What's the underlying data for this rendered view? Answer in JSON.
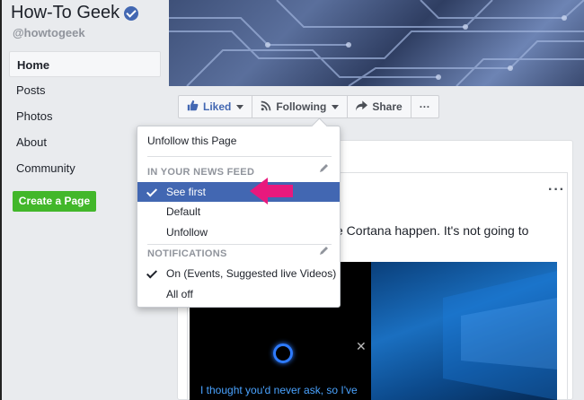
{
  "sidebar": {
    "page_name": "How-To Geek",
    "handle": "@howtogeek",
    "items": [
      {
        "label": "Home",
        "active": true
      },
      {
        "label": "Posts"
      },
      {
        "label": "Photos"
      },
      {
        "label": "About"
      },
      {
        "label": "Community"
      }
    ],
    "create_label": "Create a Page"
  },
  "action_bar": {
    "liked_label": "Liked",
    "following_label": "Following",
    "share_label": "Share",
    "more_label": "···"
  },
  "dropdown": {
    "unfollow_page": "Unfollow this Page",
    "news_feed_header": "IN YOUR NEWS FEED",
    "see_first": "See first",
    "default": "Default",
    "unfollow": "Unfollow",
    "notifications_header": "NOTIFICATIONS",
    "on": "On (Events, Suggested live Videos)",
    "all_off": "All off"
  },
  "post": {
    "text": "e Cortana happen. It's not going to",
    "dots": "···",
    "cortana_text": "I thought you'd never ask, so I've",
    "close": "✕"
  },
  "colors": {
    "fb_blue": "#4267b2",
    "green": "#42b72a",
    "highlight_arrow": "#e8197d"
  }
}
